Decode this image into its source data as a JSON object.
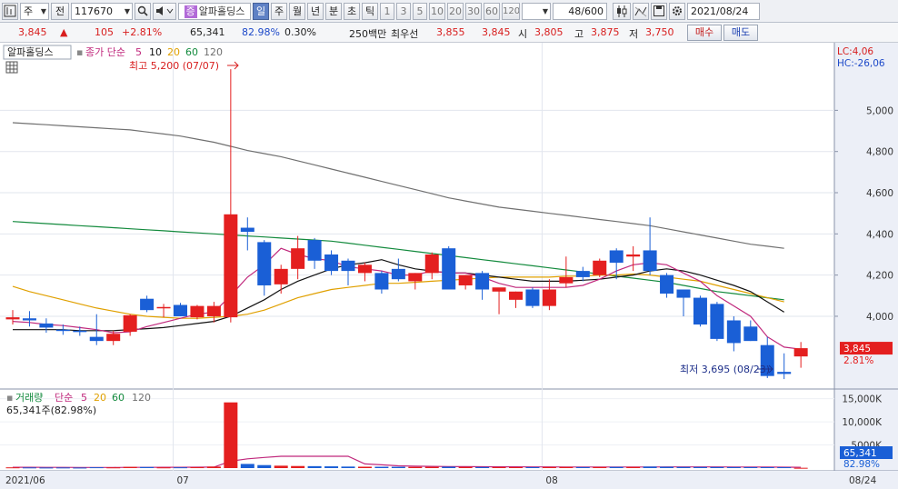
{
  "toolbar": {
    "icon_chart": "chart-window-icon",
    "market": "주",
    "prev_label": "전",
    "code": "117670",
    "stock_badge": "증",
    "stock_name": "알파홀딩스",
    "periods": [
      "일",
      "주",
      "월",
      "년",
      "분",
      "초",
      "틱"
    ],
    "active_period": "일",
    "intervals": [
      "1",
      "3",
      "5",
      "10",
      "20",
      "30",
      "60",
      "120"
    ],
    "count": "48",
    "count_total": "/600",
    "date": "2021/08/24"
  },
  "quote": {
    "price": "3,845",
    "arrow": "▲",
    "change": "105",
    "change_pct": "+2.81%",
    "volume": "65,341",
    "vol_ratio": "82.98%",
    "turnover_pct": "0.30%",
    "amount": "250백만",
    "best_bid_label": "최우선",
    "best_ask": "3,855",
    "best_bid": "3,845",
    "open_label": "시",
    "open": "3,805",
    "high_label": "고",
    "high": "3,875",
    "low_label": "저",
    "low": "3,750",
    "buy_label": "매수",
    "sell_label": "매도"
  },
  "chart_data": {
    "type": "candlestick",
    "title": "알파홀딩스",
    "legend": {
      "price_label": "종가 단순",
      "ma_periods": [
        "5",
        "10",
        "20",
        "60",
        "120"
      ],
      "ma_colors": [
        "#c0287c",
        "#111111",
        "#e0a000",
        "#138a3d",
        "#707070"
      ],
      "volume_label": "거래량",
      "volume_ma_label": "단순",
      "volume_value": "65,341주(82.98%)"
    },
    "lc_label": "LC:4,06",
    "hc_label": "HC:-26,06",
    "max_annotation": "최고 5,200 (07/07)",
    "min_annotation": "최저 3,695 (08/23)",
    "price_axis": {
      "ticks": [
        4000,
        4200,
        4400,
        4600,
        4800,
        5000
      ],
      "labels": [
        "4,000",
        "4,200",
        "4,400",
        "4,600",
        "4,800",
        "5,000"
      ],
      "ylim": [
        3660,
        5240
      ]
    },
    "current_price_label": "3,845",
    "current_pct_label": "2.81%",
    "volume_axis": {
      "ticks": [
        5000,
        10000,
        15000
      ],
      "labels": [
        "5000K",
        "10,000K",
        "15,000K"
      ],
      "ylim": [
        0,
        16500
      ]
    },
    "current_volume_label": "65,341",
    "current_volume_pct": "82.98%",
    "x_labels": [
      {
        "index": 0,
        "text": "2021/06"
      },
      {
        "index": 10,
        "text": "07"
      },
      {
        "index": 32,
        "text": "08"
      },
      {
        "index": 47,
        "text": "08/24"
      }
    ],
    "candles": [
      {
        "o": 3985,
        "h": 4030,
        "l": 3960,
        "c": 3995,
        "v": 160
      },
      {
        "o": 3990,
        "h": 4025,
        "l": 3950,
        "c": 3980,
        "v": 140
      },
      {
        "o": 3965,
        "h": 3990,
        "l": 3920,
        "c": 3945,
        "v": 120
      },
      {
        "o": 3935,
        "h": 3960,
        "l": 3910,
        "c": 3930,
        "v": 130
      },
      {
        "o": 3930,
        "h": 3950,
        "l": 3905,
        "c": 3925,
        "v": 110
      },
      {
        "o": 3900,
        "h": 4010,
        "l": 3860,
        "c": 3880,
        "v": 180
      },
      {
        "o": 3880,
        "h": 3930,
        "l": 3860,
        "c": 3915,
        "v": 150
      },
      {
        "o": 3925,
        "h": 4010,
        "l": 3905,
        "c": 4005,
        "v": 260
      },
      {
        "o": 4085,
        "h": 4100,
        "l": 4020,
        "c": 4030,
        "v": 240
      },
      {
        "o": 4040,
        "h": 4060,
        "l": 3995,
        "c": 4045,
        "v": 150
      },
      {
        "o": 4055,
        "h": 4065,
        "l": 4000,
        "c": 4000,
        "v": 170
      },
      {
        "o": 3995,
        "h": 4055,
        "l": 3985,
        "c": 4050,
        "v": 190
      },
      {
        "o": 4000,
        "h": 4070,
        "l": 3970,
        "c": 4050,
        "v": 320
      },
      {
        "o": 3995,
        "h": 5200,
        "l": 3970,
        "c": 4495,
        "v": 14200
      },
      {
        "o": 4430,
        "h": 4480,
        "l": 4320,
        "c": 4410,
        "v": 900
      },
      {
        "o": 4360,
        "h": 4370,
        "l": 4100,
        "c": 4150,
        "v": 650
      },
      {
        "o": 4155,
        "h": 4250,
        "l": 4110,
        "c": 4230,
        "v": 520
      },
      {
        "o": 4230,
        "h": 4390,
        "l": 4180,
        "c": 4330,
        "v": 450
      },
      {
        "o": 4370,
        "h": 4380,
        "l": 4230,
        "c": 4270,
        "v": 420
      },
      {
        "o": 4300,
        "h": 4320,
        "l": 4200,
        "c": 4220,
        "v": 380
      },
      {
        "o": 4270,
        "h": 4280,
        "l": 4150,
        "c": 4220,
        "v": 330
      },
      {
        "o": 4210,
        "h": 4260,
        "l": 4170,
        "c": 4250,
        "v": 300
      },
      {
        "o": 4210,
        "h": 4220,
        "l": 4110,
        "c": 4130,
        "v": 290
      },
      {
        "o": 4230,
        "h": 4280,
        "l": 4170,
        "c": 4180,
        "v": 280
      },
      {
        "o": 4170,
        "h": 4210,
        "l": 4130,
        "c": 4210,
        "v": 260
      },
      {
        "o": 4210,
        "h": 4310,
        "l": 4180,
        "c": 4300,
        "v": 270
      },
      {
        "o": 4330,
        "h": 4340,
        "l": 4130,
        "c": 4130,
        "v": 300
      },
      {
        "o": 4150,
        "h": 4200,
        "l": 4130,
        "c": 4200,
        "v": 250
      },
      {
        "o": 4210,
        "h": 4220,
        "l": 4080,
        "c": 4130,
        "v": 230
      },
      {
        "o": 4120,
        "h": 4130,
        "l": 4010,
        "c": 4140,
        "v": 220
      },
      {
        "o": 4080,
        "h": 4120,
        "l": 4040,
        "c": 4120,
        "v": 200
      },
      {
        "o": 4130,
        "h": 4140,
        "l": 4040,
        "c": 4050,
        "v": 210
      },
      {
        "o": 4050,
        "h": 4180,
        "l": 4030,
        "c": 4130,
        "v": 230
      },
      {
        "o": 4160,
        "h": 4290,
        "l": 4140,
        "c": 4190,
        "v": 240
      },
      {
        "o": 4220,
        "h": 4240,
        "l": 4170,
        "c": 4190,
        "v": 220
      },
      {
        "o": 4200,
        "h": 4280,
        "l": 4190,
        "c": 4270,
        "v": 230
      },
      {
        "o": 4320,
        "h": 4330,
        "l": 4180,
        "c": 4260,
        "v": 260
      },
      {
        "o": 4290,
        "h": 4340,
        "l": 4220,
        "c": 4300,
        "v": 250
      },
      {
        "o": 4320,
        "h": 4480,
        "l": 4200,
        "c": 4220,
        "v": 330
      },
      {
        "o": 4200,
        "h": 4210,
        "l": 4090,
        "c": 4110,
        "v": 290
      },
      {
        "o": 4130,
        "h": 4130,
        "l": 4000,
        "c": 4090,
        "v": 250
      },
      {
        "o": 4090,
        "h": 4100,
        "l": 3950,
        "c": 3960,
        "v": 240
      },
      {
        "o": 4060,
        "h": 4070,
        "l": 3880,
        "c": 3890,
        "v": 230
      },
      {
        "o": 3980,
        "h": 4000,
        "l": 3830,
        "c": 3870,
        "v": 220
      },
      {
        "o": 3950,
        "h": 3980,
        "l": 3880,
        "c": 3880,
        "v": 210
      },
      {
        "o": 3860,
        "h": 3900,
        "l": 3700,
        "c": 3710,
        "v": 200
      },
      {
        "o": 3730,
        "h": 3820,
        "l": 3695,
        "c": 3720,
        "v": 190
      },
      {
        "o": 3805,
        "h": 3875,
        "l": 3750,
        "c": 3845,
        "v": 65
      }
    ],
    "ma5": [
      3975,
      3970,
      3960,
      3955,
      3945,
      3935,
      3920,
      3925,
      3950,
      3970,
      3990,
      4010,
      4020,
      4100,
      4190,
      4250,
      4330,
      4300,
      4280,
      4270,
      4240,
      4230,
      4220,
      4200,
      4200,
      4220,
      4210,
      4210,
      4190,
      4160,
      4140,
      4140,
      4140,
      4140,
      4150,
      4180,
      4220,
      4250,
      4260,
      4250,
      4210,
      4170,
      4100,
      4050,
      4000,
      3900,
      3850,
      3840
    ],
    "ma10": [
      3935,
      3935,
      3935,
      3935,
      3930,
      3930,
      3930,
      3935,
      3940,
      3945,
      3955,
      3965,
      3975,
      4000,
      4040,
      4080,
      4130,
      4170,
      4200,
      4230,
      4250,
      4260,
      4275,
      4250,
      4230,
      4220,
      4210,
      4210,
      4200,
      4190,
      4180,
      4170,
      4170,
      4170,
      4175,
      4180,
      4190,
      4200,
      4220,
      4230,
      4220,
      4200,
      4175,
      4150,
      4120,
      4070,
      4020,
      null
    ],
    "ma20": [
      4145,
      4120,
      4100,
      4080,
      4060,
      4040,
      4025,
      4010,
      4000,
      3995,
      3990,
      3990,
      3995,
      4000,
      4010,
      4030,
      4060,
      4090,
      4110,
      4130,
      4140,
      4150,
      4160,
      4160,
      4165,
      4170,
      4175,
      4180,
      4185,
      4190,
      4190,
      4190,
      4190,
      4195,
      4195,
      4200,
      4200,
      4205,
      4200,
      4190,
      4180,
      4170,
      4150,
      4130,
      4110,
      4090,
      4070,
      null
    ],
    "ma60": [
      4460,
      4455,
      4450,
      4445,
      4440,
      4435,
      4430,
      4425,
      4420,
      4415,
      4410,
      4405,
      4400,
      4395,
      4390,
      4385,
      4380,
      4375,
      4370,
      4365,
      4355,
      4345,
      4335,
      4325,
      4315,
      4305,
      4295,
      4285,
      4275,
      4265,
      4255,
      4245,
      4235,
      4225,
      4215,
      4205,
      4195,
      4185,
      4175,
      4165,
      4150,
      4135,
      4120,
      4110,
      4100,
      4090,
      4080,
      null
    ],
    "ma120": [
      4940,
      4935,
      4930,
      4925,
      4920,
      4915,
      4910,
      4905,
      4895,
      4885,
      4875,
      4860,
      4845,
      4825,
      4805,
      4790,
      4775,
      4755,
      4735,
      4715,
      4695,
      4675,
      4655,
      4635,
      4615,
      4595,
      4575,
      4560,
      4545,
      4530,
      4520,
      4510,
      4500,
      4490,
      4480,
      4470,
      4460,
      4450,
      4440,
      4425,
      4410,
      4395,
      4380,
      4365,
      4350,
      4340,
      4330,
      null
    ],
    "vol_ma5": [
      180,
      170,
      160,
      150,
      145,
      140,
      140,
      150,
      160,
      170,
      180,
      190,
      210,
      1500,
      2000,
      2300,
      2550,
      2550,
      2550,
      2550,
      2550,
      900,
      700,
      500,
      420,
      370,
      330,
      310,
      290,
      280,
      270,
      260,
      250,
      240,
      230,
      230,
      230,
      230,
      240,
      250,
      260,
      260,
      250,
      240,
      230,
      220,
      200,
      180
    ]
  }
}
